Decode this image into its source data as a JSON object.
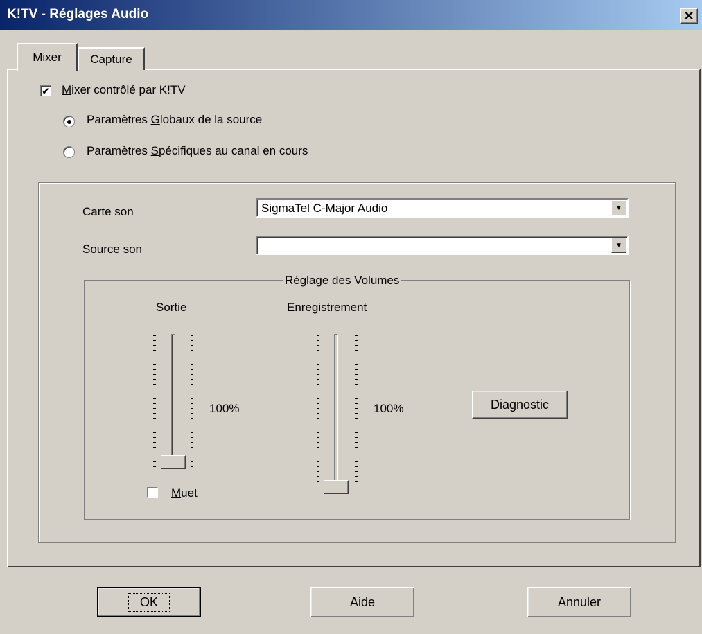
{
  "window": {
    "title": "K!TV - Réglages Audio",
    "close_icon": "close-icon"
  },
  "tabs": [
    {
      "label": "Mixer"
    },
    {
      "label": "Capture"
    }
  ],
  "mixer_control": {
    "label_rest": "ixer contrôlé par K!TV",
    "checked": true
  },
  "radios": [
    {
      "pre": "Paramètres ",
      "ul": "G",
      "post": "lobaux de la source",
      "selected": true
    },
    {
      "pre": "Paramètres ",
      "ul": "S",
      "post": "pécifiques au canal en cours",
      "selected": false
    }
  ],
  "sound_card": {
    "label": "Carte son",
    "value": "SigmaTel C-Major Audio"
  },
  "sound_source": {
    "label": "Source son",
    "value": ""
  },
  "volumes": {
    "legend": "Réglage des Volumes",
    "output": {
      "label": "Sortie",
      "percent": "100%",
      "level": 100
    },
    "record": {
      "label": "Enregistrement",
      "percent": "100%",
      "level": 100
    },
    "mute": {
      "label_rest": "uet",
      "checked": false
    },
    "diagnostic": {
      "label_rest": "iagnostic"
    }
  },
  "buttons": {
    "ok": "OK",
    "help": "Aide",
    "cancel": "Annuler"
  }
}
